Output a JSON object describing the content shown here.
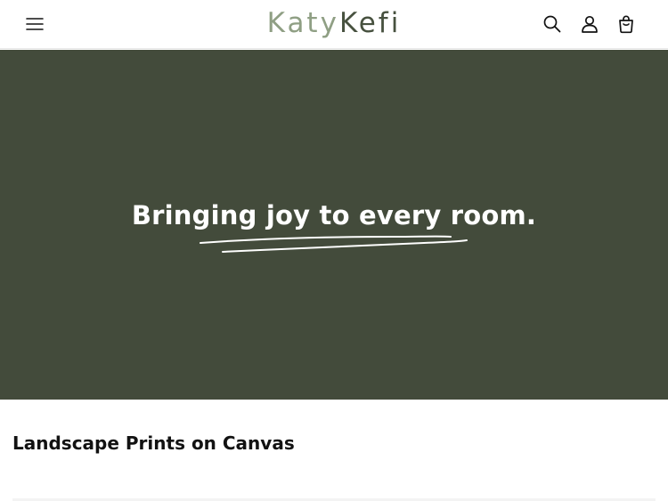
{
  "header": {
    "logo": {
      "part1": "Katy",
      "part2": "Kefi"
    },
    "icons": {
      "menu": "hamburger-menu-icon",
      "search": "search-icon",
      "account": "account-icon",
      "cart": "cart-icon"
    }
  },
  "hero": {
    "heading": "Bringing joy to every room.",
    "background_color": "#434b3b",
    "text_color": "#ffffff"
  },
  "collection": {
    "title": "Landscape Prints on Canvas"
  },
  "colors": {
    "logo_light": "#8f9f84",
    "logo_dark": "#47513f",
    "icon": "#121212"
  }
}
